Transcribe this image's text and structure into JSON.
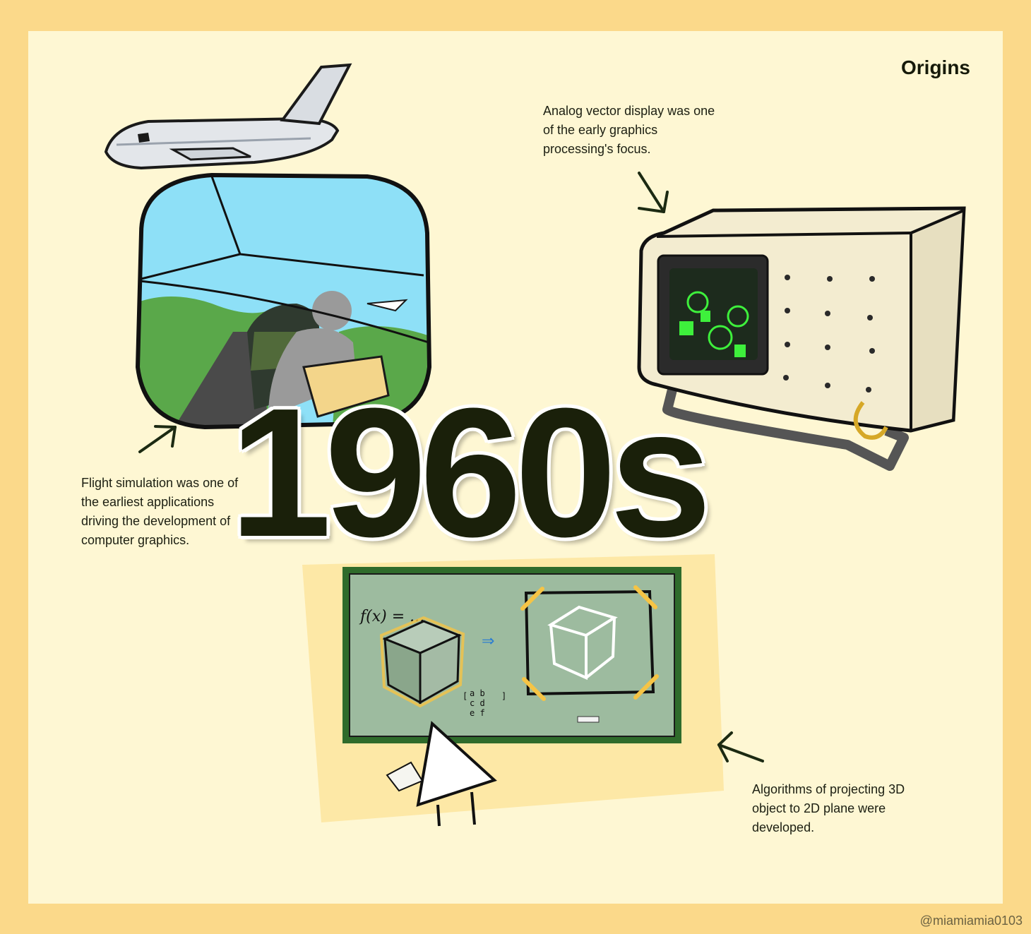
{
  "header": {
    "title": "Origins"
  },
  "headline": {
    "year": "1960s"
  },
  "captions": {
    "flight": "Flight simulation was one of the earliest applications driving the development of computer graphics.",
    "vector": "Analog vector display was one of the early graphics processing's focus.",
    "projection": "Algorithms of projecting 3D object to 2D plane were developed."
  },
  "chalkboard": {
    "formula": "f(x) = ...",
    "matrix": [
      "a b",
      "c d",
      "e f"
    ]
  },
  "footer": {
    "credit": "@miamiamia0103"
  },
  "colors": {
    "page_border": "#fbd98a",
    "panel_bg": "#fef7d3",
    "ink": "#1a200a",
    "sky": "#8ee0f7",
    "hills": "#5aa84a",
    "chalkboard": "#9dbb9f",
    "board_frame": "#2f6b2b",
    "phosphor_green": "#3ef03c",
    "monitor_case": "#f3ecd0",
    "highlight_yellow": "#f6c445"
  }
}
